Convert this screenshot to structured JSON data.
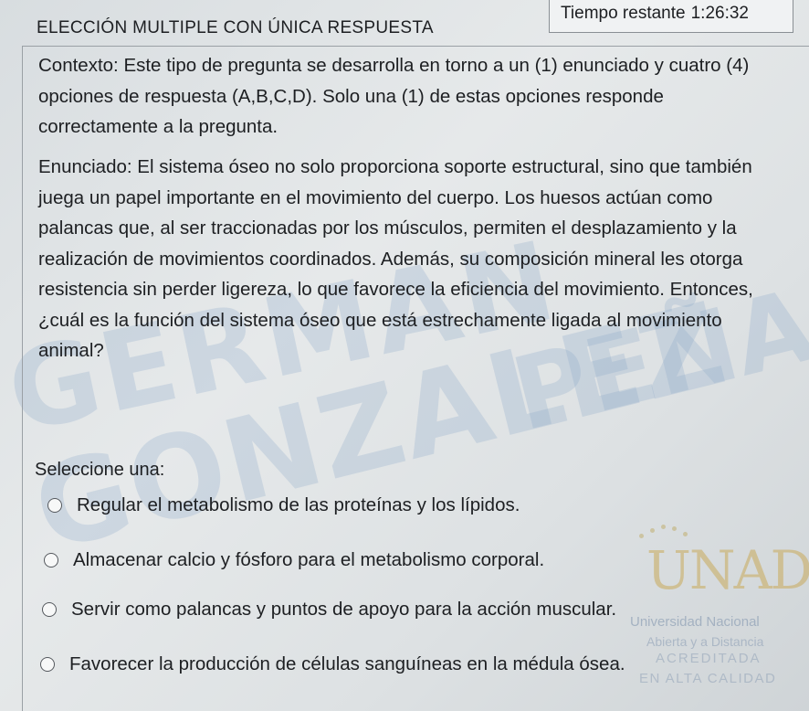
{
  "header": {
    "title": "ELECCIÓN MULTIPLE CON ÚNICA RESPUESTA",
    "timer_label": "Tiempo restante",
    "timer_value": "1:26:32"
  },
  "question": {
    "context": "Contexto: Este tipo de pregunta se desarrolla en torno a un (1) enunciado y cuatro (4) opciones de respuesta (A,B,C,D). Solo una (1) de estas opciones responde correctamente a la pregunta.",
    "statement": "Enunciado: El sistema óseo no solo proporciona soporte estructural, sino que también juega un papel importante en el movimiento del cuerpo. Los huesos actúan como palancas que, al ser traccionadas por los músculos, permiten el desplazamiento y la realización de movimientos coordinados. Además, su composición mineral les otorga resistencia sin perder ligereza, lo que favorece la eficiencia del movimiento. Entonces, ¿cuál es la función del sistema óseo que está estrechamente ligada al movimiento animal?",
    "select_label": "Seleccione una:",
    "options": [
      {
        "label": "Regular el metabolismo de las proteínas y los lípidos."
      },
      {
        "label": "Almacenar calcio y fósforo para el metabolismo corporal."
      },
      {
        "label": "Servir como palancas y puntos de apoyo para la acción muscular."
      },
      {
        "label": "Favorecer la producción de células sanguíneas en la médula ósea."
      }
    ]
  },
  "watermark": {
    "line1": "GERMAN",
    "line2": "GONZALEZ",
    "line3": "PEÑA"
  },
  "logo": {
    "mark": "UNAD",
    "line1": "Universidad Nacional",
    "line2": "Abierta y a Distancia",
    "line3": "ACREDITADA",
    "line4": "EN ALTA CALIDAD"
  },
  "colors": {
    "background": "#e2e6e8",
    "text": "#1d1f22",
    "border": "#9aa0a5"
  }
}
